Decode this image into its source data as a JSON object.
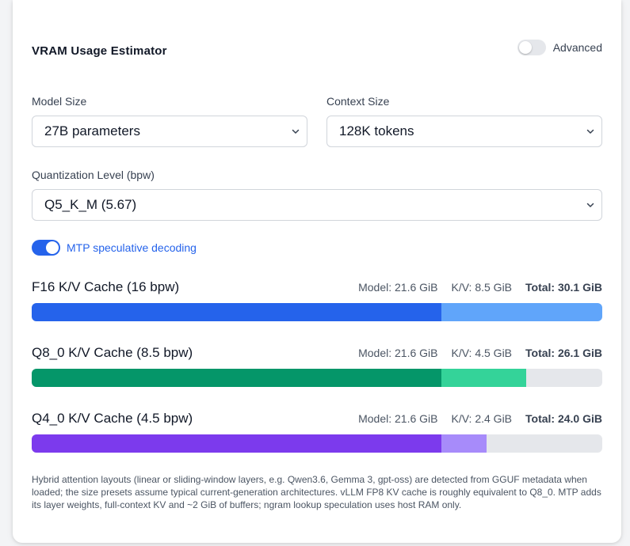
{
  "header": {
    "title": "VRAM Usage Estimator",
    "advanced_label": "Advanced",
    "advanced_on": false
  },
  "model_size": {
    "label": "Model Size",
    "value": "27B parameters"
  },
  "context_size": {
    "label": "Context Size",
    "value": "128K tokens"
  },
  "quantization": {
    "label": "Quantization Level (bpw)",
    "value": "Q5_K_M (5.67)"
  },
  "mtp": {
    "label": "MTP speculative decoding",
    "on": true
  },
  "scale_max_gib": 30.1,
  "caches": [
    {
      "title": "F16 K/V Cache (16 bpw)",
      "model": "Model: 21.6 GiB",
      "kv": "K/V: 8.5 GiB",
      "total": "Total: 30.1 GiB",
      "model_gib": 21.6,
      "kv_gib": 8.5,
      "model_color": "#2563eb",
      "kv_color": "#60a5fa"
    },
    {
      "title": "Q8_0 K/V Cache (8.5 bpw)",
      "model": "Model: 21.6 GiB",
      "kv": "K/V: 4.5 GiB",
      "total": "Total: 26.1 GiB",
      "model_gib": 21.6,
      "kv_gib": 4.5,
      "model_color": "#059669",
      "kv_color": "#34d399"
    },
    {
      "title": "Q4_0 K/V Cache (4.5 bpw)",
      "model": "Model: 21.6 GiB",
      "kv": "K/V: 2.4 GiB",
      "total": "Total: 24.0 GiB",
      "model_gib": 21.6,
      "kv_gib": 2.4,
      "model_color": "#7c3aed",
      "kv_color": "#a78bfa"
    }
  ],
  "footnote": "Hybrid attention layouts (linear or sliding-window layers, e.g. Qwen3.6, Gemma 3, gpt-oss) are detected from GGUF metadata when loaded; the size presets assume typical current-generation architectures. vLLM FP8 KV cache is roughly equivalent to Q8_0. MTP adds its layer weights, full-context KV and ~2 GiB of buffers; ngram lookup speculation uses host RAM only."
}
